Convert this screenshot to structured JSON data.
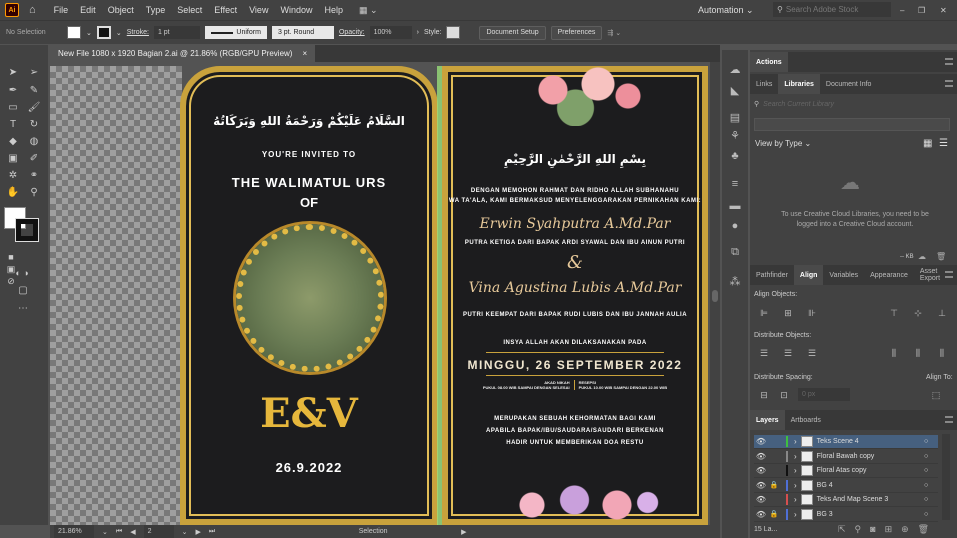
{
  "app": {
    "logo": "Ai",
    "menu": [
      "File",
      "Edit",
      "Object",
      "Type",
      "Select",
      "Effect",
      "View",
      "Window",
      "Help"
    ],
    "workspace": "Automation",
    "search_placeholder": "Search Adobe Stock"
  },
  "control": {
    "selection": "No Selection",
    "stroke_label": "Stroke:",
    "stroke_value": "1 pt",
    "profile": "Uniform",
    "brush": "3 pt. Round",
    "opacity_label": "Opacity:",
    "opacity_value": "100%",
    "style_label": "Style:",
    "document_setup": "Document Setup",
    "preferences": "Preferences"
  },
  "document": {
    "tab_title": "New File 1080 x 1920 Bagian 2.ai @ 21.86% (RGB/GPU Preview)",
    "close": "×"
  },
  "status": {
    "zoom": "21.86%",
    "artboard": "2",
    "tool": "Selection"
  },
  "artboard1": {
    "arabic": "السَّلَامُ عَلَيْكُمْ وَرَحْمَةُ اللهِ وَبَرَكَاتُهُ",
    "invited": "YOU'RE INVITED TO",
    "title1": "THE WALIMATUL URS",
    "title2": "OF",
    "initials": "E&V",
    "date": "26.9.2022"
  },
  "artboard2": {
    "arabic": "بِسْمِ اللهِ الرَّحْمٰنِ الرَّحِيْمِ",
    "intro1": "DENGAN MEMOHON RAHMAT DAN RIDHO ALLAH SUBHANAHU",
    "intro2": "WA TA'ALA, KAMI BERMAKSUD MENYELENGGARAKAN PERNIKAHAN KAMI:",
    "groom": "Erwin Syahputra A.Md.Par",
    "groom_parents": "PUTRA KETIGA DARI BAPAK ARDI SYAWAL DAN IBU AINUN PUTRI",
    "amp": "&",
    "bride": "Vina Agustina Lubis A.Md.Par",
    "bride_parents": "PUTRI KEEMPAT DARI BAPAK RUDI LUBIS DAN IBU JANNAH AULIA",
    "insya": "INSYA ALLAH AKAN DILAKSANAKAN PADA",
    "day_date": "MINGGU, 26 SEPTEMBER 2022",
    "akad": "AKAD NIKAH",
    "akad_time": "PUKUL 08.00 WIB SAMPAI DENGAN SELESAI",
    "resepsi": "RESEPSI",
    "resepsi_time": "PUKUL 10.00 WIB SAMPAI DENGAN 22.00 WIB",
    "closing1": "MERUPAKAN SEBUAH KEHORMATAN BAGI KAMI",
    "closing2": "APABILA BAPAK/IBU/SAUDARA/SAUDARI BERKENAN",
    "closing3": "HADIR UNTUK MEMBERIKAN DOA RESTU"
  },
  "panels": {
    "actions": "Actions",
    "library_tabs": [
      "Links",
      "Libraries",
      "Document Info"
    ],
    "library_search": "Search Current Library",
    "view_by": "View by Type",
    "cc_message": "To use Creative Cloud Libraries, you need to be logged into a Creative Cloud account.",
    "kb": "-- KB",
    "align_tabs": [
      "Pathfinder",
      "Align",
      "Variables",
      "Appearance",
      "Asset Export"
    ],
    "align_objects": "Align Objects:",
    "distribute_objects": "Distribute Objects:",
    "distribute_spacing": "Distribute Spacing:",
    "spacing_value": "0 px",
    "align_to": "Align To:",
    "layer_tabs": [
      "Layers",
      "Artboards"
    ],
    "layers": [
      {
        "name": "Teks Scene 4",
        "color": "#3fbf3f",
        "locked": false,
        "selected": true
      },
      {
        "name": "Floral Bawah copy",
        "color": "#888888",
        "locked": false,
        "selected": false
      },
      {
        "name": "Floral Atas copy",
        "color": "#111111",
        "locked": false,
        "selected": false
      },
      {
        "name": "BG 4",
        "color": "#4f6fd6",
        "locked": true,
        "selected": false
      },
      {
        "name": "Teks And Map Scene 3",
        "color": "#d64f4f",
        "locked": false,
        "selected": false
      },
      {
        "name": "BG 3",
        "color": "#4f6fd6",
        "locked": true,
        "selected": false
      }
    ],
    "layer_count": "15 La..."
  }
}
